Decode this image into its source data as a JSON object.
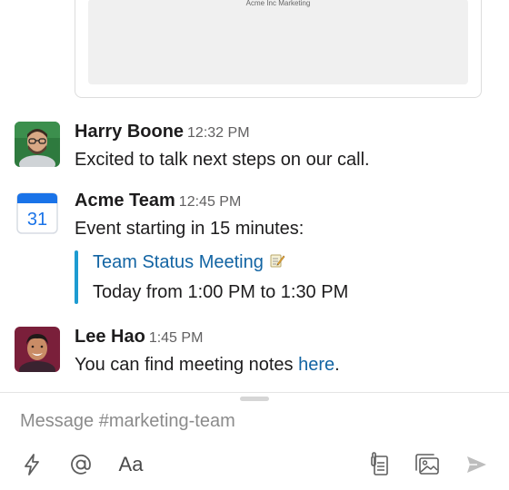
{
  "attachment": {
    "caption": "Acme Inc Marketing"
  },
  "messages": [
    {
      "author": "Harry Boone",
      "time": "12:32 PM",
      "text": "Excited to talk next steps on our call.",
      "avatar": "avatar-photo-harry"
    },
    {
      "author": "Acme Team",
      "time": "12:45 PM",
      "text": "Event starting in 15 minutes:",
      "avatar": "calendar-icon",
      "avatar_number": "31",
      "event": {
        "title": "Team Status Meeting",
        "title_icon": "memo-icon",
        "time": "Today from 1:00 PM to 1:30 PM"
      }
    },
    {
      "author": "Lee Hao",
      "time": "1:45 PM",
      "text_before_link": "You can find meeting notes ",
      "link_text": "here",
      "text_after_link": ".",
      "avatar": "avatar-photo-lee"
    }
  ],
  "composer": {
    "placeholder": "Message #marketing-team",
    "aa_label": "Aa",
    "toolbar_icons": [
      "shortcuts-lightning-icon",
      "mention-at-icon",
      "format-text-icon",
      "attach-file-icon",
      "photo-icon",
      "send-icon"
    ]
  },
  "colors": {
    "link": "#1264a3",
    "event_bar": "#1d9bd1",
    "calendar_blue": "#1a73e8"
  }
}
